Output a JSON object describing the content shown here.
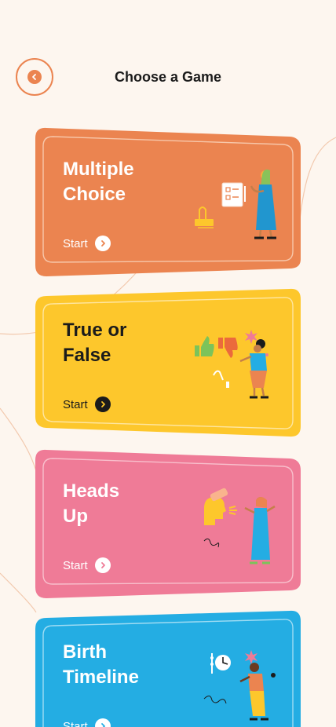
{
  "header": {
    "title": "Choose a Game",
    "back_icon": "chevron-left-icon"
  },
  "colors": {
    "background": "#FDF6EF",
    "accent": "#EB8450"
  },
  "games": [
    {
      "line1": "Multiple",
      "line2": "Choice",
      "start": "Start",
      "color": "#EB8450",
      "text_color": "#FFFFFF",
      "arrow_bg": "#FFFFFF",
      "arrow_fg": "#EB8450",
      "illustration": "quiz-checklist-illustration"
    },
    {
      "line1": "True or",
      "line2": "False",
      "start": "Start",
      "color": "#FDC72C",
      "text_color": "#1B1B1B",
      "arrow_bg": "#1B1B1B",
      "arrow_fg": "#FDC72C",
      "illustration": "thumbs-up-down-illustration"
    },
    {
      "line1": "Heads",
      "line2": "Up",
      "start": "Start",
      "color": "#EF7B97",
      "text_color": "#FFFFFF",
      "arrow_bg": "#FFFFFF",
      "arrow_fg": "#EF7B97",
      "illustration": "heads-up-illustration"
    },
    {
      "line1": "Birth",
      "line2": "Timeline",
      "start": "Start",
      "color": "#24ADE3",
      "text_color": "#FFFFFF",
      "arrow_bg": "#FFFFFF",
      "arrow_fg": "#24ADE3",
      "illustration": "timeline-clock-illustration"
    }
  ]
}
